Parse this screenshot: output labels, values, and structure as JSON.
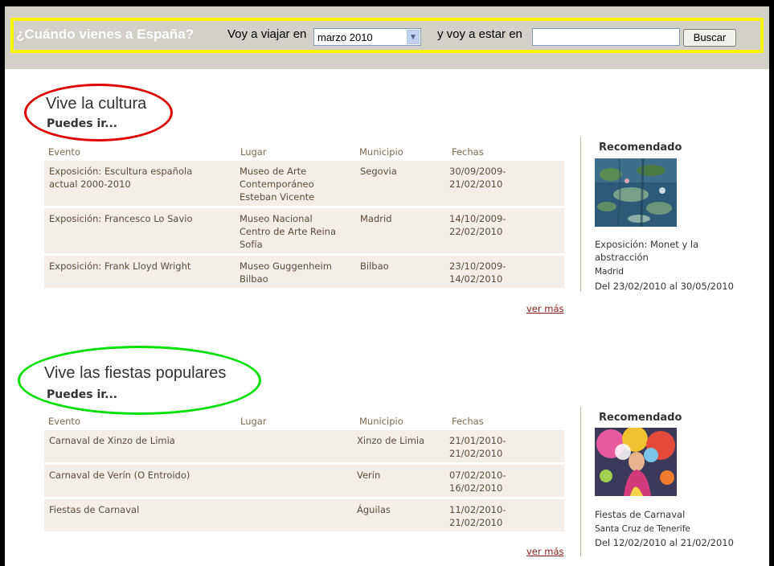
{
  "search": {
    "question": "¿Cuándo vienes a España?",
    "travel_label": "Voy a viajar en",
    "month_selected": "marzo 2010",
    "stay_label": "y voy a estar en",
    "destination_value": "",
    "button_label": "Buscar"
  },
  "culture": {
    "title": "Vive la cultura",
    "subtitle": "Puedes ir...",
    "columns": [
      "Evento",
      "Lugar",
      "Municipio",
      "Fechas"
    ],
    "rows": [
      {
        "evento": [
          "Exposición: Escultura española",
          "actual 2000-2010"
        ],
        "lugar": [
          "Museo de Arte",
          "Contemporáneo",
          "Esteban Vicente"
        ],
        "municipio": "Segovia",
        "fechas": [
          "30/09/2009-",
          "21/02/2010"
        ]
      },
      {
        "evento": [
          "Exposición: Francesco Lo Savio"
        ],
        "lugar": [
          "Museo Nacional",
          "Centro de Arte Reina",
          "Sofía"
        ],
        "municipio": "Madrid",
        "fechas": [
          "14/10/2009-",
          "22/02/2010"
        ]
      },
      {
        "evento": [
          "Exposición: Frank Lloyd Wright"
        ],
        "lugar": [
          "Museo Guggenheim",
          "Bilbao"
        ],
        "municipio": "Bilbao",
        "fechas": [
          "23/10/2009-",
          "14/02/2010"
        ]
      }
    ],
    "more_link": "ver más",
    "recommended": {
      "heading": "Recomendado",
      "title_lines": [
        "Exposición: Monet y la",
        "abstracción"
      ],
      "city": "Madrid",
      "dates": "Del 23/02/2010 al 30/05/2010"
    }
  },
  "fiestas": {
    "title": "Vive las fiestas populares",
    "subtitle": "Puedes ir...",
    "columns": [
      "Evento",
      "Lugar",
      "Municipio",
      "Fechas"
    ],
    "rows": [
      {
        "evento": [
          "Carnaval de Xinzo de Limia"
        ],
        "lugar": [
          ""
        ],
        "municipio": "Xinzo de Limia",
        "fechas": [
          "21/01/2010-",
          "21/02/2010"
        ]
      },
      {
        "evento": [
          "Carnaval de Verín (O Entroido)"
        ],
        "lugar": [
          ""
        ],
        "municipio": "Verín",
        "fechas": [
          "07/02/2010-",
          "16/02/2010"
        ]
      },
      {
        "evento": [
          "Fiestas de Carnaval"
        ],
        "lugar": [
          ""
        ],
        "municipio": "Águilas",
        "fechas": [
          "11/02/2010-",
          "21/02/2010"
        ]
      }
    ],
    "more_link": "ver más",
    "recommended": {
      "heading": "Recomendado",
      "title_lines": [
        "Fiestas de Carnaval"
      ],
      "city": "Santa Cruz de Tenerife",
      "dates": "Del 12/02/2010 al 21/02/2010"
    }
  },
  "colors": {
    "highlight_yellow": "#f5f500",
    "culture_ring": "#e00000",
    "fiestas_ring": "#00e000",
    "link_red": "#8a1a1a"
  }
}
